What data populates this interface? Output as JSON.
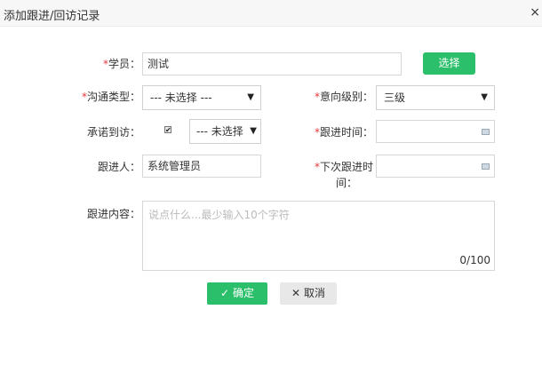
{
  "dialog": {
    "title": "添加跟进/回访记录",
    "close_symbol": "×"
  },
  "form": {
    "student": {
      "required_mark": "*",
      "label": "学员：",
      "value": "测试",
      "select_button": "选择"
    },
    "comm_type": {
      "required_mark": "*",
      "label": "沟通类型：",
      "value": "--- 未选择 ---"
    },
    "intent_level": {
      "required_mark": "*",
      "label": "意向级别：",
      "value": "三级"
    },
    "promise_visit": {
      "label": "承诺到访：",
      "checked": true,
      "check_symbol": "✔",
      "select_value": "--- 未选择"
    },
    "follow_time": {
      "required_mark": "*",
      "label": "跟进时间：",
      "value": ""
    },
    "follower": {
      "label": "跟进人：",
      "value": "系统管理员"
    },
    "next_follow_time": {
      "required_mark": "*",
      "label_line1": "下次跟进时",
      "label_line2": "间：",
      "value": ""
    },
    "content": {
      "label": "跟进内容：",
      "placeholder": "说点什么...最少输入10个字符",
      "counter": "0/100"
    }
  },
  "buttons": {
    "confirm": "确定",
    "confirm_icon": "✓",
    "cancel": "取消",
    "cancel_icon": "✕"
  },
  "icons": {
    "dropdown_arrow": "▼"
  }
}
